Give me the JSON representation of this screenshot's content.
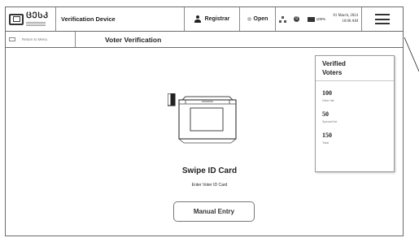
{
  "header": {
    "logo_word": "ᲪᲔᲡᲙ",
    "title": "Verification Device",
    "registrar_label": "Registrar",
    "open_label": "Open",
    "notification_count": "0",
    "battery_text": "100%",
    "date": "01 March, 2024",
    "time": "10:00 AM"
  },
  "subheader": {
    "return_label": "Return to Menu",
    "page_title": "Voter Verification"
  },
  "verified_panel": {
    "title": "Verified Voters",
    "stats": [
      {
        "value": "100",
        "label": "Voter list"
      },
      {
        "value": "50",
        "label": "Special list"
      },
      {
        "value": "150",
        "label": "Total"
      }
    ]
  },
  "main": {
    "swipe_title": "Swipe ID Card",
    "swipe_subtitle": "Enter Voter ID Card",
    "manual_entry_label": "Manual Entry"
  },
  "icons": {
    "registrar": "person-icon",
    "open_status": "status-dot-icon",
    "network": "network-icon",
    "battery": "battery-icon",
    "menu": "hamburger-menu-icon",
    "card_reader": "card-reader-icon"
  }
}
